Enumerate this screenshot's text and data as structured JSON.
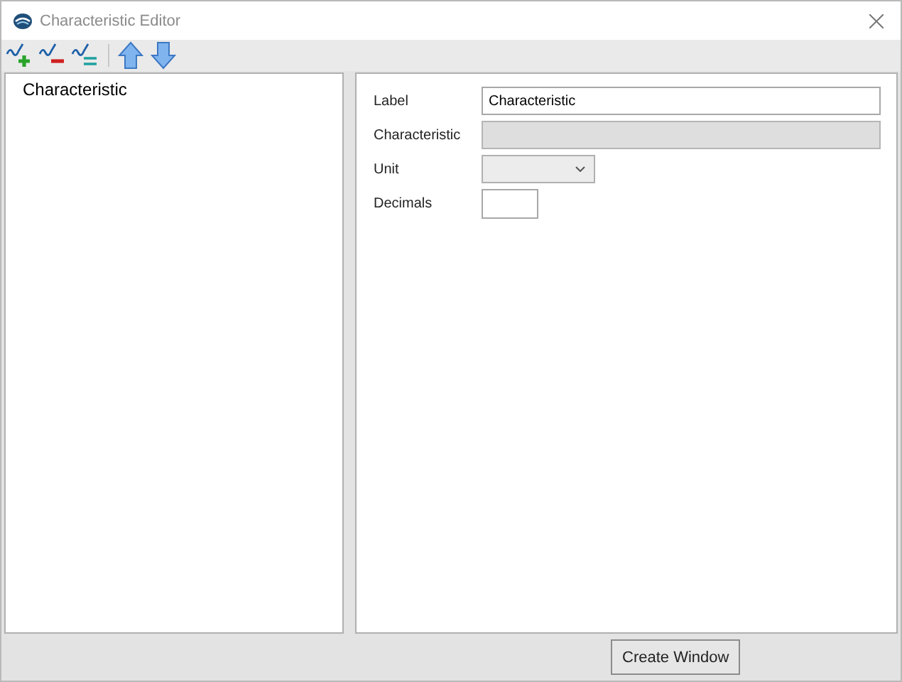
{
  "window": {
    "title": "Characteristic Editor"
  },
  "tree": {
    "items": [
      "Characteristic"
    ]
  },
  "fields": [
    {
      "label": "Label",
      "kind": "text",
      "value": "Characteristic",
      "disabled": false
    },
    {
      "label": "Characteristic",
      "kind": "text",
      "disabled": true
    },
    {
      "label": "Unit",
      "kind": "dropdown",
      "disabled": false
    },
    {
      "label": "Decimals",
      "kind": "number",
      "disabled": false
    }
  ],
  "buttons": [
    "Create Window"
  ]
}
